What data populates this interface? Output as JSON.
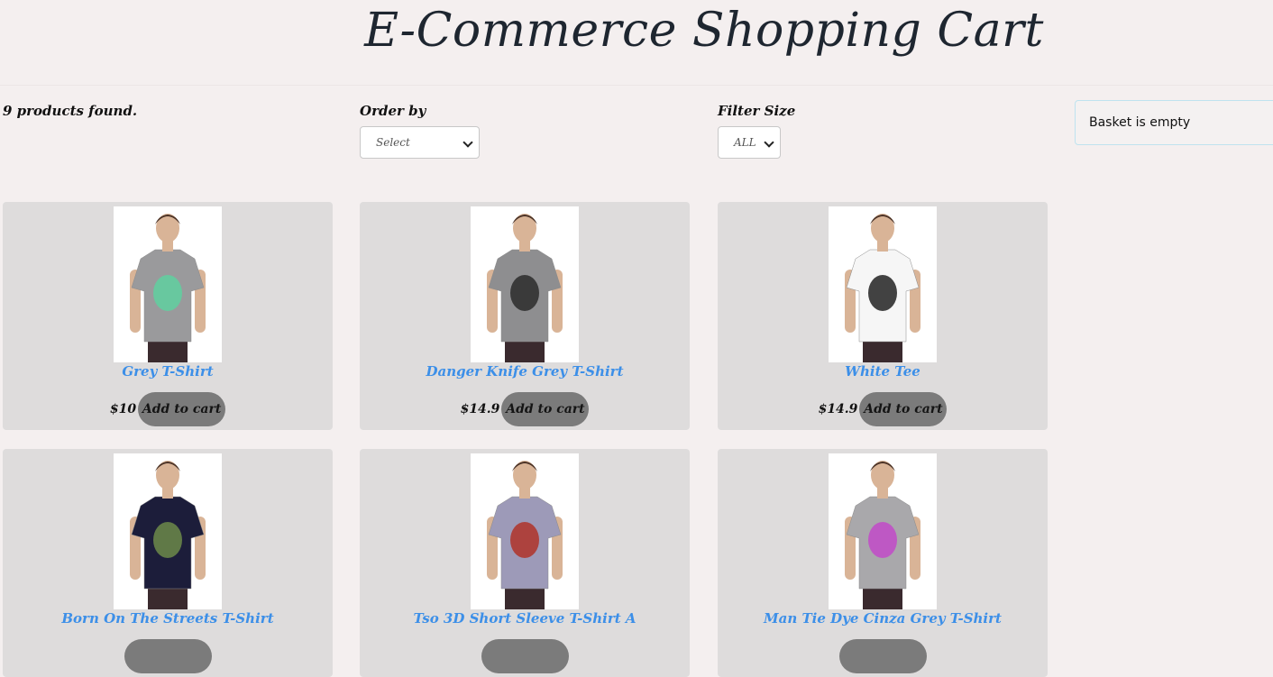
{
  "header": {
    "title": "E-Commerce Shopping Cart"
  },
  "filters": {
    "products_found": "9 products found.",
    "order_label": "Order by",
    "order_value": "Select",
    "size_label": "Filter Size",
    "size_value": "ALL"
  },
  "basket": {
    "status": "Basket is empty"
  },
  "products": [
    {
      "name": "Grey T-Shirt",
      "price": "$10",
      "button": "Add to cart",
      "shirt_color": "#9a9a9c",
      "print_color": "#5fd0a0"
    },
    {
      "name": "Danger Knife Grey T-Shirt",
      "price": "$14.9",
      "button": "Add to cart",
      "shirt_color": "#8e8e90",
      "print_color": "#2b2b2b"
    },
    {
      "name": "White Tee",
      "price": "$14.9",
      "button": "Add to cart",
      "shirt_color": "#f6f6f6",
      "print_color": "#222222"
    },
    {
      "name": "Born On The Streets T-Shirt",
      "price": "",
      "button": "",
      "shirt_color": "#1c1d3a",
      "print_color": "#6c8a4a"
    },
    {
      "name": "Tso 3D Short Sleeve T-Shirt A",
      "price": "",
      "button": "",
      "shirt_color": "#9d9ab8",
      "print_color": "#b03228"
    },
    {
      "name": "Man Tie Dye Cinza Grey T-Shirt",
      "price": "",
      "button": "",
      "shirt_color": "#a9a8ab",
      "print_color": "#c24ac8"
    }
  ]
}
